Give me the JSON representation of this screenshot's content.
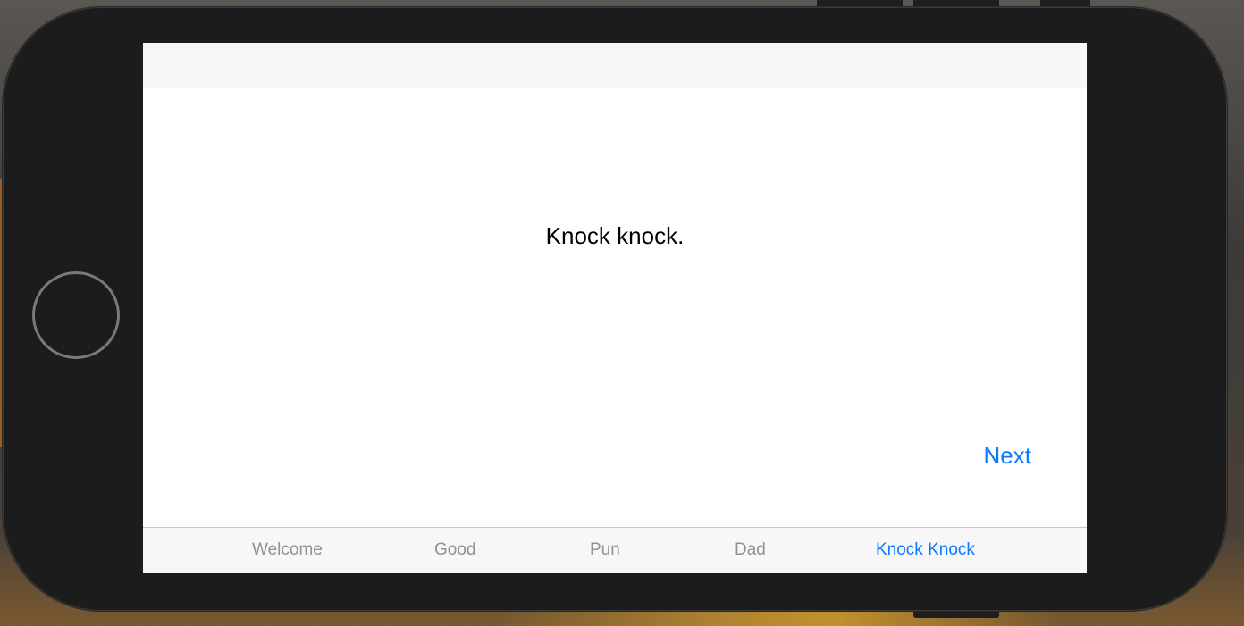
{
  "content": {
    "joke_text": "Knock knock.",
    "next_label": "Next"
  },
  "tab_bar": {
    "tabs": [
      {
        "label": "Welcome",
        "active": false
      },
      {
        "label": "Good",
        "active": false
      },
      {
        "label": "Pun",
        "active": false
      },
      {
        "label": "Dad",
        "active": false
      },
      {
        "label": "Knock Knock",
        "active": true
      }
    ]
  },
  "colors": {
    "accent": "#0a7aff",
    "inactive_tab": "#929292",
    "bar_background": "#f7f7f7"
  }
}
